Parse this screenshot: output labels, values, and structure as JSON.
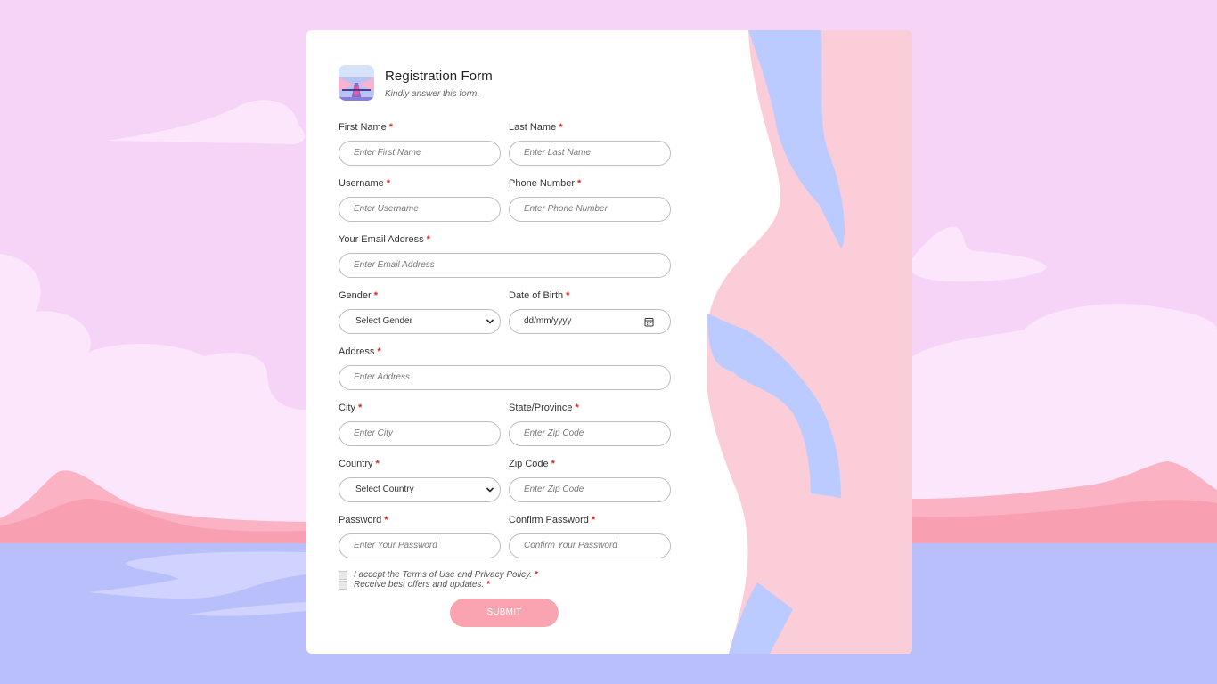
{
  "form": {
    "title": "Registration Form",
    "subtitle": "Kindly answer this form.",
    "required_mark": "*",
    "fields": {
      "first_name": {
        "label": "First Name",
        "placeholder": "Enter First Name"
      },
      "last_name": {
        "label": "Last Name",
        "placeholder": "Enter Last Name"
      },
      "username": {
        "label": "Username",
        "placeholder": "Enter Username"
      },
      "phone": {
        "label": "Phone Number",
        "placeholder": "Enter Phone Number"
      },
      "email": {
        "label": "Your Email Address",
        "placeholder": "Enter Email Address"
      },
      "gender": {
        "label": "Gender",
        "value": "Select Gender"
      },
      "dob": {
        "label": "Date of Birth",
        "value": "dd/mm/yyyy"
      },
      "address": {
        "label": "Address",
        "placeholder": "Enter Address"
      },
      "city": {
        "label": "City",
        "placeholder": "Enter City"
      },
      "state": {
        "label": "State/Province",
        "placeholder": "Enter Zip Code"
      },
      "country": {
        "label": "Country",
        "value": "Select Country"
      },
      "zip": {
        "label": "Zip Code",
        "placeholder": "Enter Zip Code"
      },
      "password": {
        "label": "Password",
        "placeholder": "Enter Your Password"
      },
      "confirm_password": {
        "label": "Confirm Password",
        "placeholder": "Confirm Your Password"
      }
    },
    "checkboxes": {
      "terms": "I accept the Terms of Use and Privacy Policy.",
      "offers": "Receive best offers and updates."
    },
    "submit_label": "SUBMIT"
  },
  "colors": {
    "background": "#f5d4f7",
    "card": "#ffffff",
    "accent_pink": "#f9a4b0",
    "art_pink": "#fbcdd8",
    "art_blue": "#bccbff",
    "required": "#e02424"
  }
}
